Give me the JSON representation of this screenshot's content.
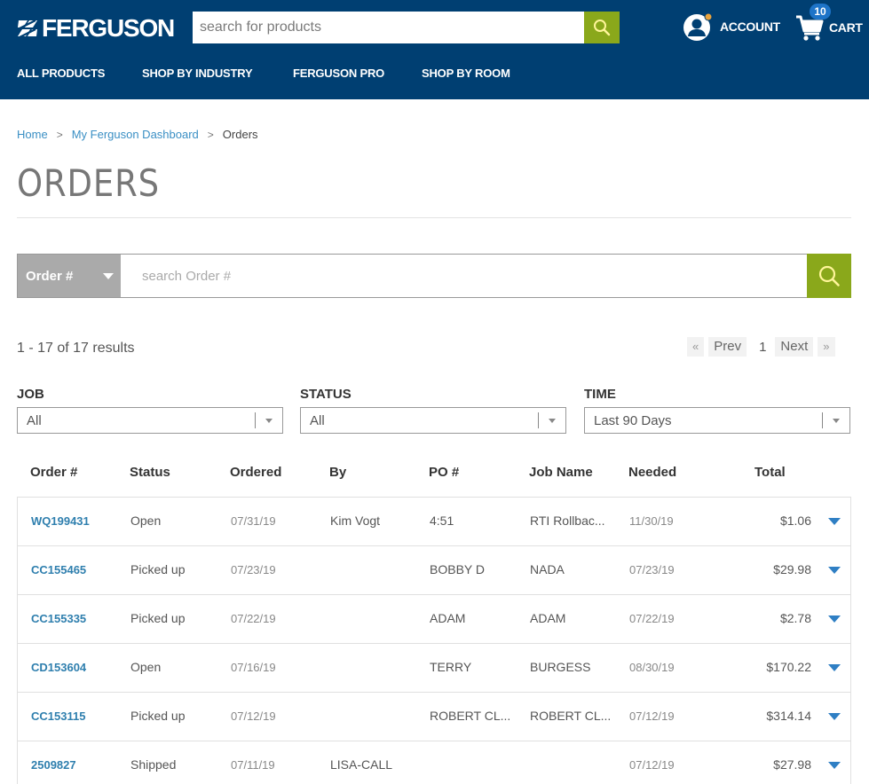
{
  "header": {
    "brand": "FERGUSON",
    "search_placeholder": "search for products",
    "account_label": "ACCOUNT",
    "cart_label": "CART",
    "cart_count": "10",
    "nav": [
      {
        "label": "ALL PRODUCTS"
      },
      {
        "label": "SHOP BY INDUSTRY"
      },
      {
        "label": "FERGUSON PRO"
      },
      {
        "label": "SHOP BY ROOM"
      }
    ]
  },
  "breadcrumb": {
    "items": [
      {
        "label": "Home"
      },
      {
        "label": "My Ferguson Dashboard"
      }
    ],
    "separator": ">",
    "current": "Orders"
  },
  "page": {
    "title": "ORDERS"
  },
  "order_search": {
    "type_label": "Order #",
    "placeholder": "search Order #"
  },
  "results": {
    "summary": "1 - 17 of 17 results"
  },
  "pagination": {
    "first": "«",
    "prev": "Prev",
    "current": "1",
    "next": "Next",
    "last": "»"
  },
  "filters": [
    {
      "label": "JOB",
      "value": "All"
    },
    {
      "label": "STATUS",
      "value": "All"
    },
    {
      "label": "TIME",
      "value": "Last 90 Days"
    }
  ],
  "table": {
    "columns": [
      "Order #",
      "Status",
      "Ordered",
      "By",
      "PO #",
      "Job Name",
      "Needed",
      "Total"
    ],
    "rows": [
      {
        "order": "WQ199431",
        "status": "Open",
        "ordered": "07/31/19",
        "by": "Kim Vogt",
        "po": "4:51",
        "job": "RTI Rollbac...",
        "needed": "11/30/19",
        "total": "$1.06"
      },
      {
        "order": "CC155465",
        "status": "Picked up",
        "ordered": "07/23/19",
        "by": "",
        "po": "BOBBY D",
        "job": "NADA",
        "needed": "07/23/19",
        "total": "$29.98"
      },
      {
        "order": "CC155335",
        "status": "Picked up",
        "ordered": "07/22/19",
        "by": "",
        "po": "ADAM",
        "job": "ADAM",
        "needed": "07/22/19",
        "total": "$2.78"
      },
      {
        "order": "CD153604",
        "status": "Open",
        "ordered": "07/16/19",
        "by": "",
        "po": "TERRY",
        "job": "BURGESS",
        "needed": "08/30/19",
        "total": "$170.22"
      },
      {
        "order": "CC153115",
        "status": "Picked up",
        "ordered": "07/12/19",
        "by": "",
        "po": "ROBERT CL...",
        "job": "ROBERT CL...",
        "needed": "07/12/19",
        "total": "$314.14"
      },
      {
        "order": "2509827",
        "status": "Shipped",
        "ordered": "07/11/19",
        "by": "LISA-CALL",
        "po": "",
        "job": "",
        "needed": "07/12/19",
        "total": "$27.98"
      }
    ]
  },
  "colors": {
    "header_bg": "#003f72",
    "accent_green": "#8aa81b",
    "link_blue": "#2f7fae",
    "badge_blue": "#1e74c8",
    "account_dot": "#e8a33d"
  }
}
